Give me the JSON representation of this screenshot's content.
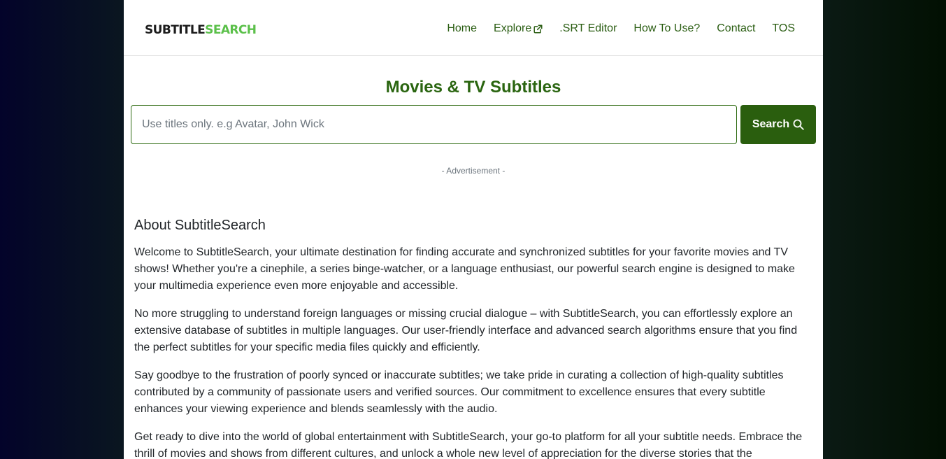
{
  "brand": {
    "logo_part1": "SUBTITLE",
    "logo_part2": "SEARCH",
    "logo_color1": "#1c1c1c",
    "logo_color2": "#5bc04a"
  },
  "nav": {
    "home": "Home",
    "explore": "Explore",
    "srt_editor": ".SRT Editor",
    "how_to_use": "How To Use?",
    "contact": "Contact",
    "tos": "TOS"
  },
  "hero": {
    "title": "Movies & TV Subtitles"
  },
  "search": {
    "placeholder": "Use titles only. e.g Avatar, John Wick",
    "value": "",
    "button_label": "Search"
  },
  "ad": {
    "label": "- Advertisement -"
  },
  "about": {
    "heading": "About SubtitleSearch",
    "paragraphs": [
      "Welcome to SubtitleSearch, your ultimate destination for finding accurate and synchronized subtitles for your favorite movies and TV shows! Whether you're a cinephile, a series binge-watcher, or a language enthusiast, our powerful search engine is designed to make your multimedia experience even more enjoyable and accessible.",
      "No more struggling to understand foreign languages or missing crucial dialogue – with SubtitleSearch, you can effortlessly explore an extensive database of subtitles in multiple languages. Our user-friendly interface and advanced search algorithms ensure that you find the perfect subtitles for your specific media files quickly and efficiently.",
      "Say goodbye to the frustration of poorly synced or inaccurate subtitles; we take pride in curating a collection of high-quality subtitles contributed by a community of passionate users and verified sources. Our commitment to excellence ensures that every subtitle enhances your viewing experience and blends seamlessly with the audio.",
      "Get ready to dive into the world of global entertainment with SubtitleSearch, your go-to platform for all your subtitle needs. Embrace the thrill of movies and shows from different cultures, and unlock a whole new level of appreciation for the diverse stories that the"
    ]
  },
  "colors": {
    "accent": "#2a5e0e",
    "nav_link": "#2a5d12",
    "title": "#2a6510"
  },
  "icons": {
    "explore": "external-link-icon",
    "search": "search-icon"
  }
}
